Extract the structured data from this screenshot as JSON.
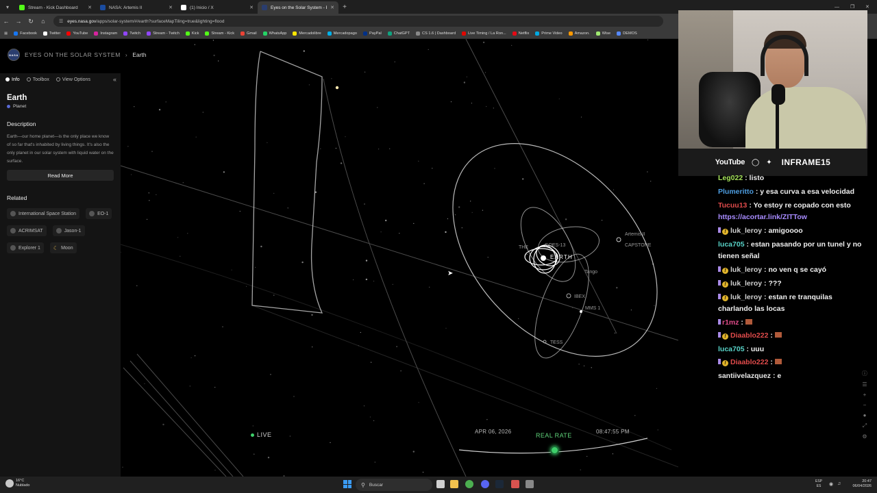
{
  "browser": {
    "tabs": [
      {
        "title": "Stream - Kick Dashboard",
        "color": "#53fc18",
        "active": false
      },
      {
        "title": "NASA: Artemis II",
        "color": "#1a4ca0",
        "active": false
      },
      {
        "title": "(1) Inicio / X",
        "color": "#ffffff",
        "active": false
      },
      {
        "title": "Eyes on the Solar System - Earth",
        "color": "#2a3d6e",
        "active": true
      }
    ],
    "url_host": "eyes.nasa.gov",
    "url_path": "/apps/solar-system/#/earth?surfaceMapTiling=true&lighting=flood",
    "bookmarks": [
      {
        "label": "Facebook",
        "color": "#1877f2"
      },
      {
        "label": "Twitter",
        "color": "#ffffff"
      },
      {
        "label": "YouTube",
        "color": "#ff0000"
      },
      {
        "label": "Instagram",
        "color": "#d6249f"
      },
      {
        "label": "Twitch",
        "color": "#9146ff"
      },
      {
        "label": "Stream - Twitch",
        "color": "#9146ff"
      },
      {
        "label": "Kick",
        "color": "#53fc18"
      },
      {
        "label": "Stream - Kick",
        "color": "#53fc18"
      },
      {
        "label": "Gmail",
        "color": "#ea4335"
      },
      {
        "label": "WhatsApp",
        "color": "#25d366"
      },
      {
        "label": "Mercadolibre",
        "color": "#ffe600"
      },
      {
        "label": "Mercadopago",
        "color": "#00b1ea"
      },
      {
        "label": "PayPal",
        "color": "#003087"
      },
      {
        "label": "ChatGPT",
        "color": "#10a37f"
      },
      {
        "label": "CS 1.6 | Dashboard",
        "color": "#888888"
      },
      {
        "label": "Live Timing / La Ron...",
        "color": "#e10600"
      },
      {
        "label": "Netflix",
        "color": "#e50914"
      },
      {
        "label": "Prime Video",
        "color": "#00a8e1"
      },
      {
        "label": "Amazon.",
        "color": "#ff9900"
      },
      {
        "label": "Wise",
        "color": "#9fe870"
      },
      {
        "label": "DEMOS",
        "color": "#5588ff"
      }
    ]
  },
  "app": {
    "site_name": "EYES ON THE SOLAR SYSTEM",
    "breadcrumb": "Earth",
    "logo_text": "NASA",
    "panel_tabs": [
      "Info",
      "Toolbox",
      "View Options"
    ],
    "title": "Earth",
    "subtitle": "Planet",
    "description_heading": "Description",
    "description": "Earth—our home planet—is the only place we know of so far that's inhabited by living things. It's also the only planet in our solar system with liquid water on the surface.",
    "read_more": "Read More",
    "related_heading": "Related",
    "related": [
      "International Space Station",
      "EO-1",
      "ACRIMSAT",
      "Jason-1",
      "Explorer 1",
      "Moon"
    ],
    "live_label": "LIVE",
    "date": "APR 06, 2026",
    "rate_label": "REAL RATE",
    "time": "08:47:55 PM",
    "space_labels": {
      "earth": "EARTH",
      "artemis": "Artemis II",
      "capstone": "CAPSTONE",
      "tango": "Tango",
      "ibex": "IBEX",
      "mms": "MMS 1",
      "tess": "TESS",
      "themis": "THE",
      "goes": "GOES-13"
    }
  },
  "stream": {
    "platform": "YouTube",
    "handle": "INFRAME15"
  },
  "chat": [
    {
      "user": "Leg022",
      "color": "#a6e35c",
      "text": "listo",
      "badges": []
    },
    {
      "user": "Plumeritto",
      "color": "#4d9de0",
      "text": "y esa curva a esa velocidad",
      "badges": []
    },
    {
      "user": "Tucuu13",
      "color": "#e04b4b",
      "text": "Yo estoy re copado con esto",
      "badges": []
    },
    {
      "user": "",
      "color": "#a88cff",
      "text": "https://acortar.link/ZITTow",
      "badges": []
    },
    {
      "user": "luk_leroy",
      "color": "#d0d0d0",
      "text": "amigoooo",
      "badges": [
        "sub",
        "gold"
      ]
    },
    {
      "user": "luca705",
      "color": "#58d3c8",
      "text": "estan pasando por un tunel y no tienen señal",
      "badges": []
    },
    {
      "user": "luk_leroy",
      "color": "#d0d0d0",
      "text": "no ven q se cayó",
      "badges": [
        "sub",
        "gold"
      ]
    },
    {
      "user": "luk_leroy",
      "color": "#d0d0d0",
      "text": "???",
      "badges": [
        "sub",
        "gold"
      ]
    },
    {
      "user": "luk_leroy",
      "color": "#d0d0d0",
      "text": "estan re tranquilas charlando las locas",
      "badges": [
        "sub",
        "gold"
      ]
    },
    {
      "user": "r1mz",
      "color": "#e04b8a",
      "text": "",
      "badges": [
        "sub"
      ]
    },
    {
      "user": "Diaablo222",
      "color": "#e04b4b",
      "text": "",
      "badges": [
        "sub",
        "gold"
      ]
    },
    {
      "user": "luca705",
      "color": "#58d3c8",
      "text": "uuu",
      "badges": []
    },
    {
      "user": "Diaablo222",
      "color": "#e04b4b",
      "text": "",
      "badges": [
        "sub",
        "gold"
      ]
    },
    {
      "user": "santiivelazquez",
      "color": "#e8e8e8",
      "text": "e",
      "badges": []
    }
  ],
  "taskbar": {
    "temperature": "16°C",
    "weather": "Nublado",
    "search_placeholder": "Buscar",
    "lang": "ESP",
    "lang_sub": "ES",
    "clock_time": "20:47",
    "clock_date": "06/04/2026"
  }
}
